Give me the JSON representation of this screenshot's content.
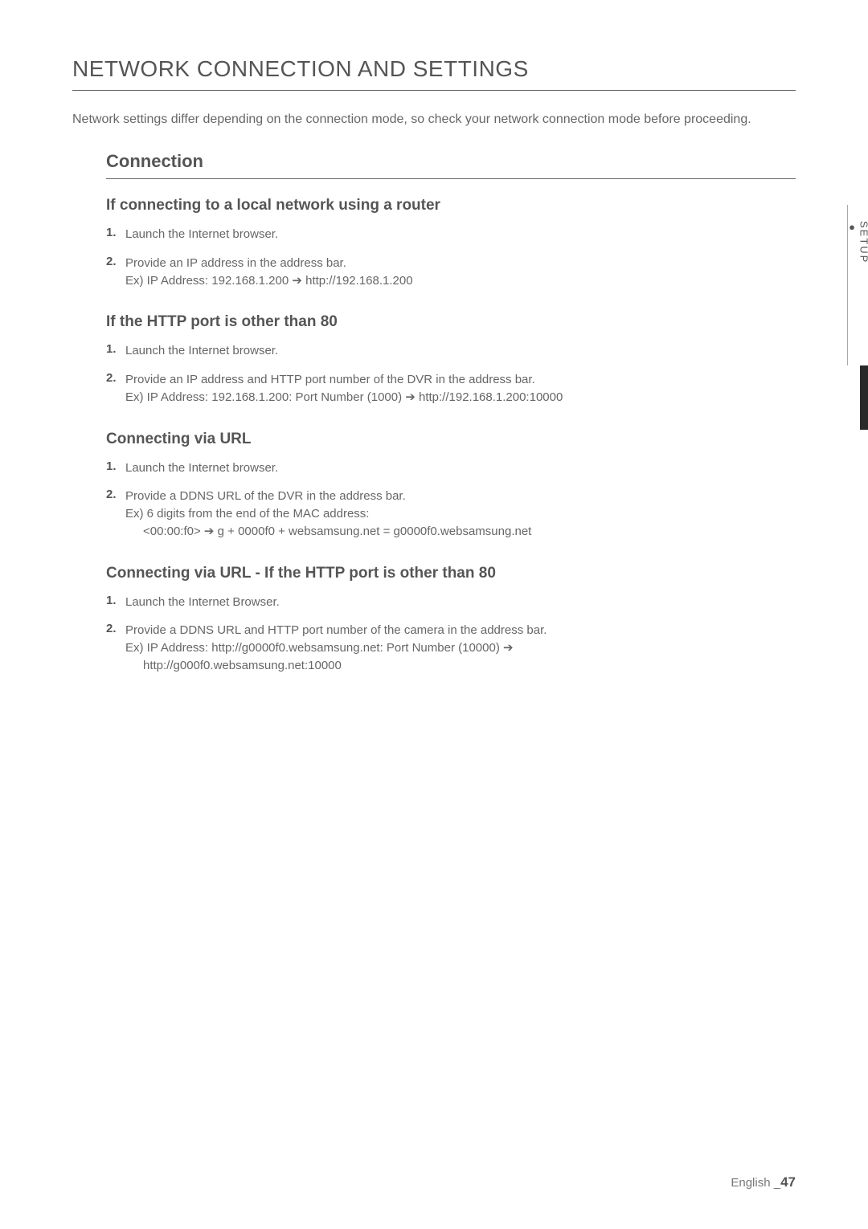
{
  "page": {
    "main_title": "NETWORK CONNECTION AND SETTINGS",
    "intro": "Network settings differ depending on the connection mode, so check your network connection mode before proceeding.",
    "section_title": "Connection",
    "side_tab": "SETUP",
    "footer_lang": "English _",
    "footer_page": "47"
  },
  "sections": {
    "s1": {
      "title": "If connecting to a local network using a router",
      "steps": {
        "n1": "1.",
        "t1": "Launch the Internet browser.",
        "n2": "2.",
        "t2a": "Provide an IP address in the address bar.",
        "t2b": "Ex) IP Address: 192.168.1.200 ➔ http://192.168.1.200"
      }
    },
    "s2": {
      "title": "If the HTTP port is other than 80",
      "steps": {
        "n1": "1.",
        "t1": "Launch the Internet browser.",
        "n2": "2.",
        "t2a": "Provide an IP address and HTTP port number of the DVR in the address bar.",
        "t2b": "Ex) IP Address: 192.168.1.200: Port Number (1000) ➔ http://192.168.1.200:10000"
      }
    },
    "s3": {
      "title": "Connecting via URL",
      "steps": {
        "n1": "1.",
        "t1": "Launch the Internet browser.",
        "n2": "2.",
        "t2a": "Provide a DDNS URL of the DVR in the address bar.",
        "t2b": "Ex) 6 digits from the end of the MAC address:",
        "t2c": "<00:00:f0> ➔ g + 0000f0 + websamsung.net = g0000f0.websamsung.net"
      }
    },
    "s4": {
      "title": "Connecting via URL - If the HTTP port is other than 80",
      "steps": {
        "n1": "1.",
        "t1": "Launch the Internet Browser.",
        "n2": "2.",
        "t2a": "Provide a DDNS URL and HTTP port number of the camera in the address bar.",
        "t2b": "Ex) IP Address: http://g0000f0.websamsung.net: Port Number (10000) ➔",
        "t2c": "http://g000f0.websamsung.net:10000"
      }
    }
  }
}
